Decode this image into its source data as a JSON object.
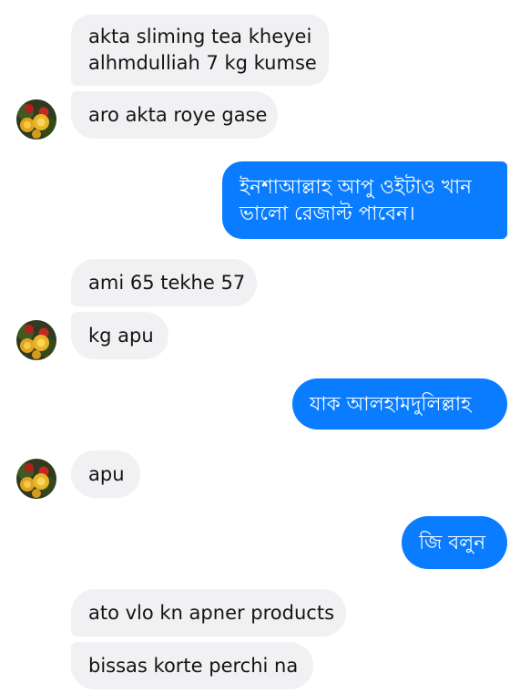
{
  "messages": [
    {
      "side": "incoming",
      "lines": [
        "akta sliming tea kheyei",
        "alhmdulliah 7 kg kumse"
      ]
    },
    {
      "side": "incoming",
      "lines": [
        "aro akta roye gase"
      ]
    },
    {
      "side": "outgoing",
      "lines": [
        "ইনশাআল্লাহ আপু ওইটাও খান",
        "ভালো রেজাল্ট পাবেন।"
      ]
    },
    {
      "side": "incoming",
      "lines": [
        "ami 65 tekhe 57"
      ]
    },
    {
      "side": "incoming",
      "lines": [
        "kg apu"
      ]
    },
    {
      "side": "outgoing",
      "lines": [
        "যাক আলহামদুলিল্লাহ"
      ]
    },
    {
      "side": "incoming",
      "lines": [
        "apu"
      ]
    },
    {
      "side": "outgoing",
      "lines": [
        "জি বলুন"
      ]
    },
    {
      "side": "incoming",
      "lines": [
        "ato vlo kn apner products"
      ]
    },
    {
      "side": "incoming",
      "lines": [
        "bissas korte perchi na"
      ]
    }
  ],
  "avatar": {
    "icon": "rose-flower-icon"
  },
  "colors": {
    "outgoing_bubble": "#0a7cff",
    "incoming_bubble": "#f1f1f3",
    "incoming_text": "#141414",
    "outgoing_text": "#ffffff"
  }
}
